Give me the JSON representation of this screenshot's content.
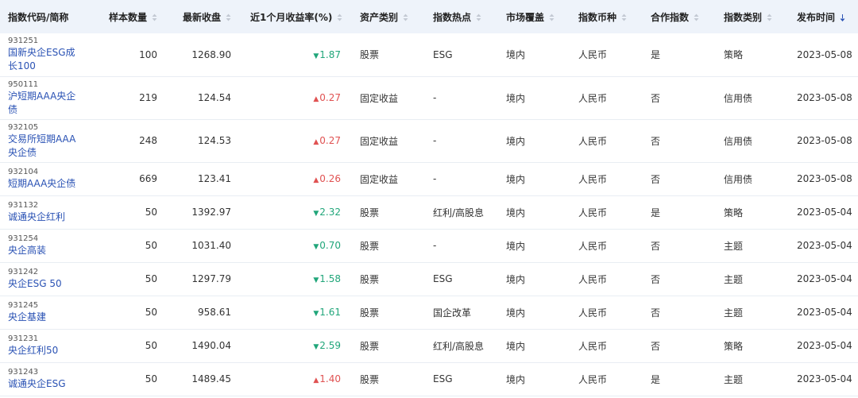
{
  "columns": [
    {
      "key": "code_name",
      "label": "指数代码/简称",
      "sortable": false
    },
    {
      "key": "sample_count",
      "label": "样本数量",
      "sortable": true
    },
    {
      "key": "latest_close",
      "label": "最新收盘",
      "sortable": true
    },
    {
      "key": "month_return",
      "label": "近1个月收益率(%)",
      "sortable": true
    },
    {
      "key": "asset_class",
      "label": "资产类别",
      "sortable": true
    },
    {
      "key": "hot_topic",
      "label": "指数热点",
      "sortable": true
    },
    {
      "key": "market",
      "label": "市场覆盖",
      "sortable": true
    },
    {
      "key": "currency",
      "label": "指数币种",
      "sortable": true
    },
    {
      "key": "cooperative",
      "label": "合作指数",
      "sortable": true
    },
    {
      "key": "index_type",
      "label": "指数类别",
      "sortable": true
    },
    {
      "key": "publish_date",
      "label": "发布时间",
      "sortable": true,
      "sorted": "desc"
    }
  ],
  "colors": {
    "header_bg": "#eef3fa",
    "link": "#2a52b4",
    "up": "#e05252",
    "down": "#21a67a"
  },
  "rows": [
    {
      "code": "931251",
      "name": "国新央企ESG成长100",
      "sample_count": "100",
      "latest_close": "1268.90",
      "direction": "down",
      "month_return": "1.87",
      "asset_class": "股票",
      "hot_topic": "ESG",
      "market": "境内",
      "currency": "人民币",
      "cooperative": "是",
      "index_type": "策略",
      "publish_date": "2023-05-08"
    },
    {
      "code": "950111",
      "name": "沪短期AAA央企债",
      "sample_count": "219",
      "latest_close": "124.54",
      "direction": "up",
      "month_return": "0.27",
      "asset_class": "固定收益",
      "hot_topic": "-",
      "market": "境内",
      "currency": "人民币",
      "cooperative": "否",
      "index_type": "信用债",
      "publish_date": "2023-05-08"
    },
    {
      "code": "932105",
      "name": "交易所短期AAA央企债",
      "sample_count": "248",
      "latest_close": "124.53",
      "direction": "up",
      "month_return": "0.27",
      "asset_class": "固定收益",
      "hot_topic": "-",
      "market": "境内",
      "currency": "人民币",
      "cooperative": "否",
      "index_type": "信用债",
      "publish_date": "2023-05-08"
    },
    {
      "code": "932104",
      "name": "短期AAA央企债",
      "sample_count": "669",
      "latest_close": "123.41",
      "direction": "up",
      "month_return": "0.26",
      "asset_class": "固定收益",
      "hot_topic": "-",
      "market": "境内",
      "currency": "人民币",
      "cooperative": "否",
      "index_type": "信用债",
      "publish_date": "2023-05-08"
    },
    {
      "code": "931132",
      "name": "诚通央企红利",
      "sample_count": "50",
      "latest_close": "1392.97",
      "direction": "down",
      "month_return": "2.32",
      "asset_class": "股票",
      "hot_topic": "红利/高股息",
      "market": "境内",
      "currency": "人民币",
      "cooperative": "是",
      "index_type": "策略",
      "publish_date": "2023-05-04"
    },
    {
      "code": "931254",
      "name": "央企高装",
      "sample_count": "50",
      "latest_close": "1031.40",
      "direction": "down",
      "month_return": "0.70",
      "asset_class": "股票",
      "hot_topic": "-",
      "market": "境内",
      "currency": "人民币",
      "cooperative": "否",
      "index_type": "主题",
      "publish_date": "2023-05-04"
    },
    {
      "code": "931242",
      "name": "央企ESG 50",
      "sample_count": "50",
      "latest_close": "1297.79",
      "direction": "down",
      "month_return": "1.58",
      "asset_class": "股票",
      "hot_topic": "ESG",
      "market": "境内",
      "currency": "人民币",
      "cooperative": "否",
      "index_type": "主题",
      "publish_date": "2023-05-04"
    },
    {
      "code": "931245",
      "name": "央企基建",
      "sample_count": "50",
      "latest_close": "958.61",
      "direction": "down",
      "month_return": "1.61",
      "asset_class": "股票",
      "hot_topic": "国企改革",
      "market": "境内",
      "currency": "人民币",
      "cooperative": "否",
      "index_type": "主题",
      "publish_date": "2023-05-04"
    },
    {
      "code": "931231",
      "name": "央企红利50",
      "sample_count": "50",
      "latest_close": "1490.04",
      "direction": "down",
      "month_return": "2.59",
      "asset_class": "股票",
      "hot_topic": "红利/高股息",
      "market": "境内",
      "currency": "人民币",
      "cooperative": "否",
      "index_type": "策略",
      "publish_date": "2023-05-04"
    },
    {
      "code": "931243",
      "name": "诚通央企ESG",
      "sample_count": "50",
      "latest_close": "1489.45",
      "direction": "up",
      "month_return": "1.40",
      "asset_class": "股票",
      "hot_topic": "ESG",
      "market": "境内",
      "currency": "人民币",
      "cooperative": "是",
      "index_type": "主题",
      "publish_date": "2023-05-04"
    }
  ]
}
